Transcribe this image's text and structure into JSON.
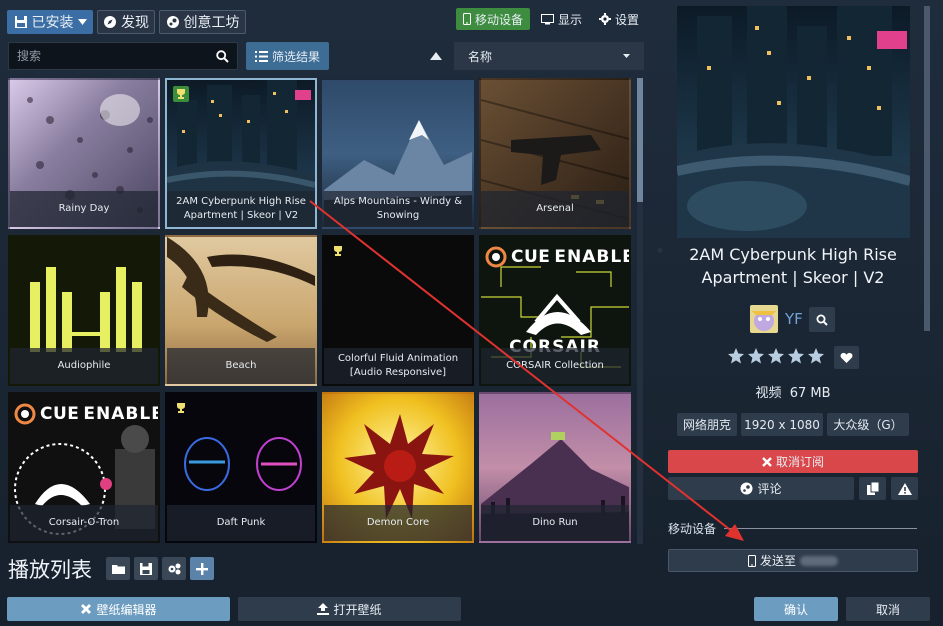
{
  "toolbar": {
    "installed_label": "已安装",
    "discover_label": "发现",
    "workshop_label": "创意工坊",
    "mobile_label": "移动设备",
    "display_label": "显示",
    "settings_label": "设置"
  },
  "search": {
    "placeholder": "搜索"
  },
  "filter": {
    "label": "筛选结果"
  },
  "sort": {
    "label": "名称"
  },
  "wallpapers": [
    {
      "title": "Rainy Day"
    },
    {
      "title": "2AM Cyberpunk High Rise Apartment | Skeor | V2",
      "selected": true
    },
    {
      "title": "Alps Mountains - Windy & Snowing"
    },
    {
      "title": "Arsenal"
    },
    {
      "title": "Audiophile"
    },
    {
      "title": "Beach"
    },
    {
      "title": "Colorful Fluid Animation [Audio Responsive]"
    },
    {
      "title": "CORSAIR Collection"
    },
    {
      "title": "Corsair-O-Tron"
    },
    {
      "title": "Daft Punk"
    },
    {
      "title": "Demon Core"
    },
    {
      "title": "Dino Run"
    }
  ],
  "cue_badge": {
    "cue": "CUE",
    "enabled": "ENABLED",
    "brand": "CORSAIR"
  },
  "playlist": {
    "title": "播放列表"
  },
  "bottom": {
    "editor_label": "壁纸编辑器",
    "open_label": "打开壁纸",
    "ok_label": "确认",
    "cancel_label": "取消"
  },
  "detail": {
    "title": "2AM Cyberpunk High Rise Apartment | Skeor | V2",
    "author": "YF",
    "rating": 5,
    "type_size": "视频  67 MB",
    "tags": [
      "网络朋克",
      "1920 x 1080",
      "大众级（G）"
    ],
    "unsubscribe_label": "取消订阅",
    "comment_label": "评论",
    "mobile_section": "移动设备",
    "send_label": "发送至"
  },
  "colors": {
    "accent_blue": "#3b6ea5",
    "mobile_green": "#3d8c3f",
    "unsubscribe_red": "#d9474a",
    "arrow_red": "#e0332f"
  }
}
